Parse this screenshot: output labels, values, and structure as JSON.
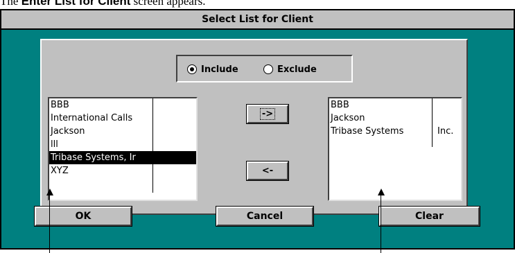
{
  "caption": {
    "prefix": "The",
    "bold": "Enter List for Client",
    "suffix": "screen appears."
  },
  "window": {
    "title": "Select List for Client"
  },
  "radio": {
    "include_label": "Include",
    "exclude_label": "Exclude",
    "selected": "Include"
  },
  "left_list": {
    "items": [
      {
        "c1": "BBB",
        "c2": ""
      },
      {
        "c1": "International Calls",
        "c2": ""
      },
      {
        "c1": "Jackson",
        "c2": ""
      },
      {
        "c1": "lll",
        "c2": ""
      },
      {
        "c1": "Tribase Systems, Ir",
        "c2": "",
        "selected": true
      },
      {
        "c1": "XYZ",
        "c2": ""
      }
    ]
  },
  "right_list": {
    "items": [
      {
        "c1": "BBB",
        "c2": ""
      },
      {
        "c1": "Jackson",
        "c2": ""
      },
      {
        "c1": "Tribase Systems",
        "c2": "Inc."
      }
    ]
  },
  "buttons": {
    "add": "->",
    "remove": "<-",
    "ok": "OK",
    "cancel": "Cancel",
    "clear": "Clear"
  },
  "colors": {
    "window_bg": "#008080",
    "panel_bg": "#c0c0c0",
    "selection": "#000000"
  }
}
